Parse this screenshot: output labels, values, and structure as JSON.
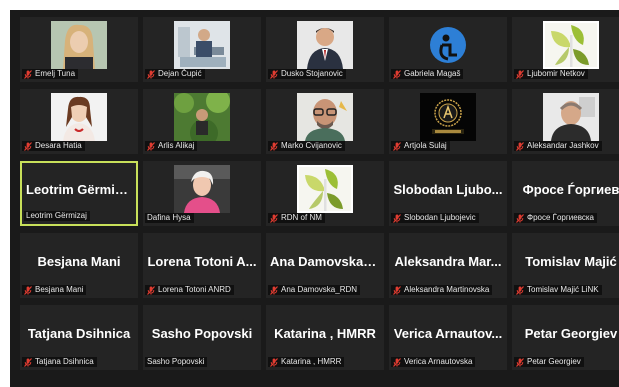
{
  "colors": {
    "muted": "#e03c31",
    "active_speaker": "#c8e05a",
    "tile_bg": "#242424"
  },
  "participants": [
    {
      "name": "Emelj Tuna",
      "muted": true,
      "video": true,
      "photo": "emelj"
    },
    {
      "name": "Dejan Čupić",
      "muted": true,
      "video": true,
      "photo": "dejan"
    },
    {
      "name": "Dusko Stojanovic",
      "muted": true,
      "video": true,
      "photo": "dusko"
    },
    {
      "name": "Gabriela Magaš",
      "muted": true,
      "video": true,
      "photo": "gabriela"
    },
    {
      "name": "Ljubomir Netkov",
      "muted": true,
      "video": true,
      "photo": "ljubomir"
    },
    {
      "name": "Desara Hatia",
      "muted": true,
      "video": true,
      "photo": "desara"
    },
    {
      "name": "Arlis Alikaj",
      "muted": true,
      "video": true,
      "photo": "arlis"
    },
    {
      "name": "Marko Cvijanovic",
      "muted": true,
      "video": true,
      "photo": "marko"
    },
    {
      "name": "Artjola Sulaj",
      "muted": true,
      "video": true,
      "photo": "artjola"
    },
    {
      "name": "Aleksandar Jashkov",
      "muted": true,
      "video": true,
      "photo": "aleksandar"
    },
    {
      "name": "Leotrim Gërmizaj",
      "display": "Leotrim Gërmizaj",
      "muted": false,
      "video": false,
      "active": true
    },
    {
      "name": "Dafina Hysa",
      "muted": false,
      "video": true,
      "photo": "dafina"
    },
    {
      "name": "RDN of NM",
      "muted": true,
      "video": true,
      "photo": "rdn"
    },
    {
      "name": "Slobodan Ljubojevic",
      "display": "Slobodan Ljubo...",
      "muted": true,
      "video": false
    },
    {
      "name": "Фросе Ѓоргиевска",
      "display": "Фросе Ѓоргиев",
      "muted": true,
      "video": false
    },
    {
      "name": "Besjana Mani",
      "display": "Besjana Mani",
      "muted": true,
      "video": false
    },
    {
      "name": "Lorena Totoni ANRD",
      "display": "Lorena Totoni A...",
      "muted": true,
      "video": false
    },
    {
      "name": "Ana Damovska_RDN",
      "display": "Ana Damovska_...",
      "muted": true,
      "video": false
    },
    {
      "name": "Aleksandra Martinovska",
      "display": "Aleksandra Mar...",
      "muted": true,
      "video": false
    },
    {
      "name": "Tomislav Majić LiNK",
      "display": "Tomislav Majić",
      "muted": true,
      "video": false
    },
    {
      "name": "Tatjana Dsihnica",
      "display": "Tatjana Dsihnica",
      "muted": true,
      "video": false
    },
    {
      "name": "Sasho Popovski",
      "display": "Sasho Popovski",
      "muted": false,
      "video": false
    },
    {
      "name": "Katarina , HMRR",
      "display": "Katarina , HMRR",
      "muted": true,
      "video": false
    },
    {
      "name": "Verica Arnautovska",
      "display": "Verica Arnautov...",
      "muted": true,
      "video": false
    },
    {
      "name": "Petar Georgiev",
      "display": "Petar Georgiev",
      "muted": true,
      "video": false
    }
  ]
}
